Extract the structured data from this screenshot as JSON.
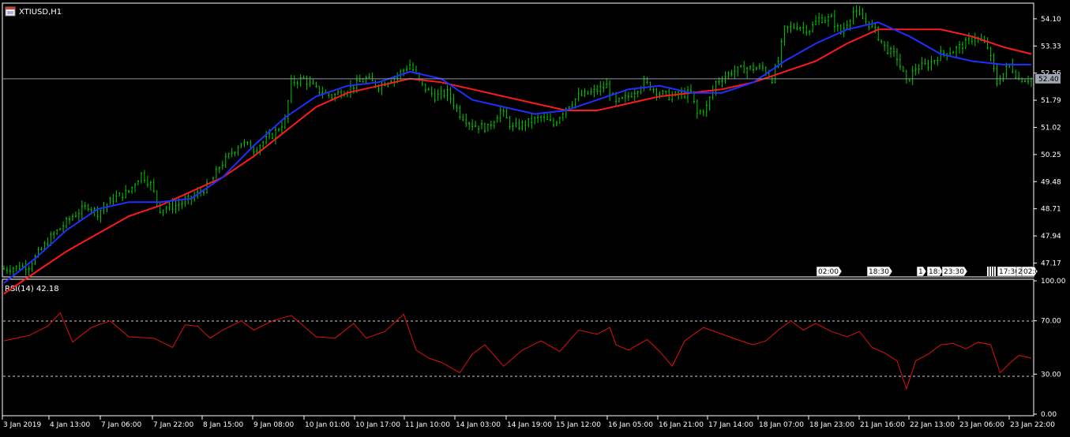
{
  "window": {
    "title": "XTIUSD,H1",
    "icon": "chart-window-icon"
  },
  "colors": {
    "background": "#000000",
    "grid_frame": "#ffffff",
    "candle": "#00c800",
    "ma_fast": "#1e2fff",
    "ma_slow": "#ff1a1a",
    "rsi": "#e01010",
    "price_line": "#8a96a8",
    "current_price_bg": "#a0a8b4"
  },
  "chart_data": [
    {
      "type": "candlestick",
      "title": "XTIUSD,H1",
      "symbol": "XTIUSD",
      "timeframe": "H1",
      "ylim": [
        46.8,
        54.5
      ],
      "y_ticks": [
        "54.10",
        "53.33",
        "52.56",
        "51.79",
        "51.02",
        "50.25",
        "49.48",
        "48.71",
        "47.94",
        "47.17"
      ],
      "current_price": "52.40",
      "x_ticks": [
        "3 Jan 2019",
        "4 Jan 13:00",
        "7 Jan 06:00",
        "7 Jan 22:00",
        "8 Jan 15:00",
        "9 Jan 08:00",
        "10 Jan 01:00",
        "10 Jan 17:00",
        "11 Jan 10:00",
        "14 Jan 03:00",
        "14 Jan 19:00",
        "15 Jan 12:00",
        "16 Jan 05:00",
        "16 Jan 21:00",
        "17 Jan 14:00",
        "18 Jan 07:00",
        "18 Jan 23:00",
        "21 Jan 16:00",
        "22 Jan 13:00",
        "23 Jan 06:00",
        "23 Jan 22:00"
      ],
      "close_path": [
        [
          0,
          47.0
        ],
        [
          8,
          47.1
        ],
        [
          15,
          47.9
        ],
        [
          22,
          48.5
        ],
        [
          27,
          48.8
        ],
        [
          30,
          48.6
        ],
        [
          35,
          49.0
        ],
        [
          40,
          49.2
        ],
        [
          44,
          49.7
        ],
        [
          47,
          49.4
        ],
        [
          50,
          48.7
        ],
        [
          55,
          48.8
        ],
        [
          60,
          49.0
        ],
        [
          66,
          49.4
        ],
        [
          69,
          49.9
        ],
        [
          72,
          50.2
        ],
        [
          76,
          50.6
        ],
        [
          80,
          50.4
        ],
        [
          86,
          50.8
        ],
        [
          90,
          51.2
        ],
        [
          92,
          52.3
        ],
        [
          96,
          52.4
        ],
        [
          100,
          52.1
        ],
        [
          105,
          51.9
        ],
        [
          110,
          52.1
        ],
        [
          116,
          52.4
        ],
        [
          120,
          52.2
        ],
        [
          126,
          52.5
        ],
        [
          130,
          52.8
        ],
        [
          134,
          52.2
        ],
        [
          138,
          51.9
        ],
        [
          142,
          52.0
        ],
        [
          146,
          51.4
        ],
        [
          150,
          51.1
        ],
        [
          155,
          51.0
        ],
        [
          159,
          51.5
        ],
        [
          163,
          51.0
        ],
        [
          166,
          51.1
        ],
        [
          172,
          51.3
        ],
        [
          176,
          51.1
        ],
        [
          180,
          51.6
        ],
        [
          184,
          51.9
        ],
        [
          188,
          52.0
        ],
        [
          193,
          52.2
        ],
        [
          196,
          51.7
        ],
        [
          200,
          51.9
        ],
        [
          205,
          52.3
        ],
        [
          210,
          52.0
        ],
        [
          213,
          51.9
        ],
        [
          220,
          52.0
        ],
        [
          222,
          51.4
        ],
        [
          225,
          51.6
        ],
        [
          228,
          52.3
        ],
        [
          233,
          52.6
        ],
        [
          238,
          52.7
        ],
        [
          243,
          52.7
        ],
        [
          246,
          52.4
        ],
        [
          248,
          52.9
        ],
        [
          250,
          53.8
        ],
        [
          254,
          53.9
        ],
        [
          258,
          53.8
        ],
        [
          261,
          54.1
        ],
        [
          265,
          54.1
        ],
        [
          268,
          53.7
        ],
        [
          272,
          54.3
        ],
        [
          275,
          54.1
        ],
        [
          278,
          53.9
        ],
        [
          282,
          53.3
        ],
        [
          286,
          53.0
        ],
        [
          289,
          52.3
        ],
        [
          292,
          52.7
        ],
        [
          296,
          52.8
        ],
        [
          300,
          53.1
        ],
        [
          304,
          53.2
        ],
        [
          308,
          53.4
        ],
        [
          311,
          53.6
        ],
        [
          315,
          53.3
        ],
        [
          318,
          52.3
        ],
        [
          322,
          52.8
        ],
        [
          325,
          52.4
        ],
        [
          329,
          52.4
        ]
      ],
      "series": [
        {
          "name": "",
          "kind": "moving-average-fast",
          "values": [
            [
              0,
              46.6
            ],
            [
              10,
              47.3
            ],
            [
              20,
              48.1
            ],
            [
              30,
              48.7
            ],
            [
              40,
              48.9
            ],
            [
              50,
              48.9
            ],
            [
              60,
              49.0
            ],
            [
              70,
              49.6
            ],
            [
              80,
              50.5
            ],
            [
              90,
              51.3
            ],
            [
              100,
              51.9
            ],
            [
              110,
              52.2
            ],
            [
              120,
              52.3
            ],
            [
              130,
              52.6
            ],
            [
              140,
              52.4
            ],
            [
              150,
              51.8
            ],
            [
              160,
              51.6
            ],
            [
              170,
              51.4
            ],
            [
              180,
              51.5
            ],
            [
              190,
              51.8
            ],
            [
              200,
              52.1
            ],
            [
              210,
              52.2
            ],
            [
              220,
              52.0
            ],
            [
              230,
              52.0
            ],
            [
              240,
              52.3
            ],
            [
              250,
              52.9
            ],
            [
              260,
              53.4
            ],
            [
              270,
              53.8
            ],
            [
              280,
              54.0
            ],
            [
              290,
              53.6
            ],
            [
              300,
              53.1
            ],
            [
              310,
              52.9
            ],
            [
              320,
              52.8
            ],
            [
              329,
              52.8
            ]
          ]
        },
        {
          "name": "",
          "kind": "moving-average-slow",
          "values": [
            [
              0,
              46.3
            ],
            [
              10,
              46.9
            ],
            [
              20,
              47.5
            ],
            [
              30,
              48.0
            ],
            [
              40,
              48.5
            ],
            [
              50,
              48.8
            ],
            [
              60,
              49.2
            ],
            [
              70,
              49.6
            ],
            [
              80,
              50.2
            ],
            [
              90,
              50.9
            ],
            [
              100,
              51.6
            ],
            [
              110,
              52.0
            ],
            [
              120,
              52.2
            ],
            [
              130,
              52.4
            ],
            [
              140,
              52.3
            ],
            [
              150,
              52.1
            ],
            [
              160,
              51.9
            ],
            [
              170,
              51.7
            ],
            [
              180,
              51.5
            ],
            [
              190,
              51.5
            ],
            [
              200,
              51.7
            ],
            [
              210,
              51.9
            ],
            [
              220,
              52.0
            ],
            [
              230,
              52.1
            ],
            [
              240,
              52.3
            ],
            [
              250,
              52.6
            ],
            [
              260,
              52.9
            ],
            [
              270,
              53.4
            ],
            [
              280,
              53.8
            ],
            [
              290,
              53.8
            ],
            [
              300,
              53.8
            ],
            [
              310,
              53.6
            ],
            [
              320,
              53.3
            ],
            [
              329,
              53.1
            ]
          ]
        }
      ],
      "time_markers": [
        "02:00",
        "18:30",
        "1",
        "18:3",
        "23:30",
        "17:30",
        "2",
        "02:0"
      ]
    },
    {
      "type": "line",
      "title": "RSI(14) 42.18",
      "indicator": "RSI(14)",
      "current_value": "42.18",
      "ylim": [
        0,
        100
      ],
      "y_ticks": [
        "100.00",
        "70.00",
        "30.00",
        "0.00"
      ],
      "levels": [
        70,
        30
      ],
      "values": [
        [
          0,
          55
        ],
        [
          8,
          59
        ],
        [
          14,
          66
        ],
        [
          18,
          76
        ],
        [
          22,
          54
        ],
        [
          28,
          65
        ],
        [
          34,
          70
        ],
        [
          40,
          58
        ],
        [
          48,
          57
        ],
        [
          54,
          50
        ],
        [
          58,
          67
        ],
        [
          62,
          66
        ],
        [
          66,
          57
        ],
        [
          70,
          63
        ],
        [
          76,
          70
        ],
        [
          80,
          63
        ],
        [
          86,
          70
        ],
        [
          92,
          74
        ],
        [
          100,
          58
        ],
        [
          106,
          57
        ],
        [
          112,
          68
        ],
        [
          116,
          57
        ],
        [
          122,
          62
        ],
        [
          128,
          75
        ],
        [
          132,
          48
        ],
        [
          136,
          42
        ],
        [
          140,
          39
        ],
        [
          146,
          31
        ],
        [
          150,
          45
        ],
        [
          154,
          52
        ],
        [
          160,
          36
        ],
        [
          166,
          48
        ],
        [
          172,
          55
        ],
        [
          178,
          47
        ],
        [
          184,
          63
        ],
        [
          190,
          60
        ],
        [
          194,
          65
        ],
        [
          196,
          52
        ],
        [
          200,
          48
        ],
        [
          206,
          56
        ],
        [
          210,
          47
        ],
        [
          214,
          36
        ],
        [
          218,
          55
        ],
        [
          224,
          65
        ],
        [
          230,
          60
        ],
        [
          236,
          55
        ],
        [
          240,
          52
        ],
        [
          244,
          55
        ],
        [
          248,
          63
        ],
        [
          252,
          70
        ],
        [
          256,
          63
        ],
        [
          260,
          68
        ],
        [
          265,
          62
        ],
        [
          270,
          58
        ],
        [
          274,
          62
        ],
        [
          278,
          50
        ],
        [
          282,
          46
        ],
        [
          286,
          40
        ],
        [
          289,
          19
        ],
        [
          292,
          40
        ],
        [
          296,
          45
        ],
        [
          300,
          52
        ],
        [
          304,
          53
        ],
        [
          308,
          49
        ],
        [
          312,
          54
        ],
        [
          316,
          52
        ],
        [
          319,
          31
        ],
        [
          322,
          38
        ],
        [
          325,
          44
        ],
        [
          329,
          42
        ]
      ]
    }
  ]
}
